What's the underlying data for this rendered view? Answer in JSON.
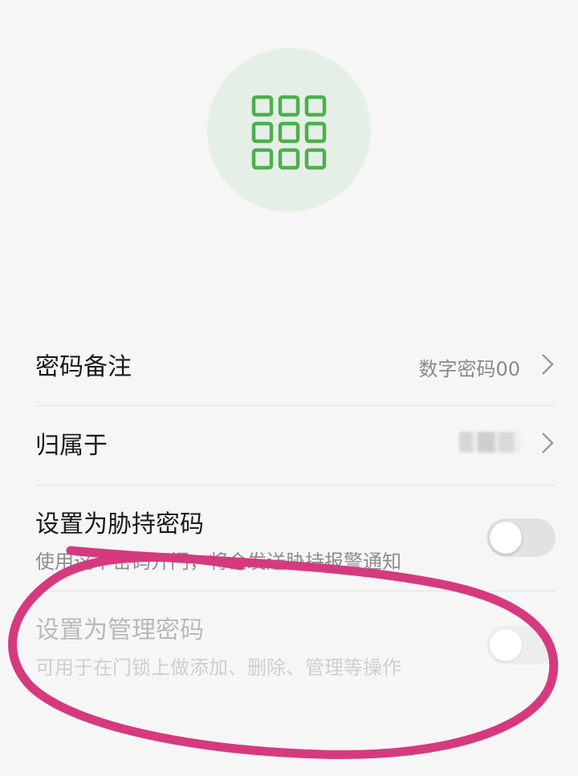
{
  "header": {
    "icon": "keypad-icon",
    "accent_color": "#4caf50",
    "circle_color": "#e6efe6"
  },
  "settings": {
    "remark": {
      "label": "密码备注",
      "value": "数字密码00"
    },
    "belongs_to": {
      "label": "归属于",
      "value_obscured": true
    },
    "duress": {
      "label": "设置为胁持密码",
      "description": "使用这个密码开门，将会发送胁持报警通知",
      "enabled": false
    },
    "admin": {
      "label": "设置为管理密码",
      "description": "可用于在门锁上做添加、删除、管理等操作",
      "enabled": false,
      "disabled": true
    }
  },
  "annotation": {
    "shape": "hand-drawn-loop",
    "color": "#d63a7e"
  }
}
